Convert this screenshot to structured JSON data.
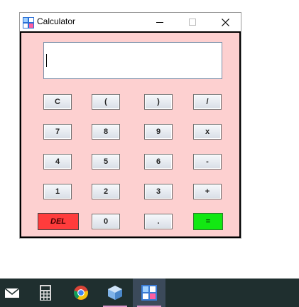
{
  "window": {
    "title": "Calculator",
    "minimize_label": "—",
    "maximize_label": "☐",
    "close_label": "✕"
  },
  "display": {
    "value": ""
  },
  "keys": {
    "clear": "C",
    "paren_open": "(",
    "paren_close": ")",
    "divide": "/",
    "seven": "7",
    "eight": "8",
    "nine": "9",
    "multiply": "x",
    "four": "4",
    "five": "5",
    "six": "6",
    "subtract": "-",
    "one": "1",
    "two": "2",
    "three": "3",
    "add": "+",
    "delete": "DEL",
    "zero": "0",
    "decimal": ".",
    "equals": "="
  },
  "colors": {
    "panel_bg": "#fdd0d0",
    "delete_bg": "#ff3c3c",
    "equals_bg": "#12e812",
    "taskbar_bg": "#1f2f2f"
  },
  "taskbar": {
    "items": [
      {
        "icon": "mail-icon"
      },
      {
        "icon": "calculator-icon"
      },
      {
        "icon": "chrome-icon"
      },
      {
        "icon": "virtualbox-icon"
      },
      {
        "icon": "calculator-app-icon",
        "active": true
      }
    ]
  }
}
